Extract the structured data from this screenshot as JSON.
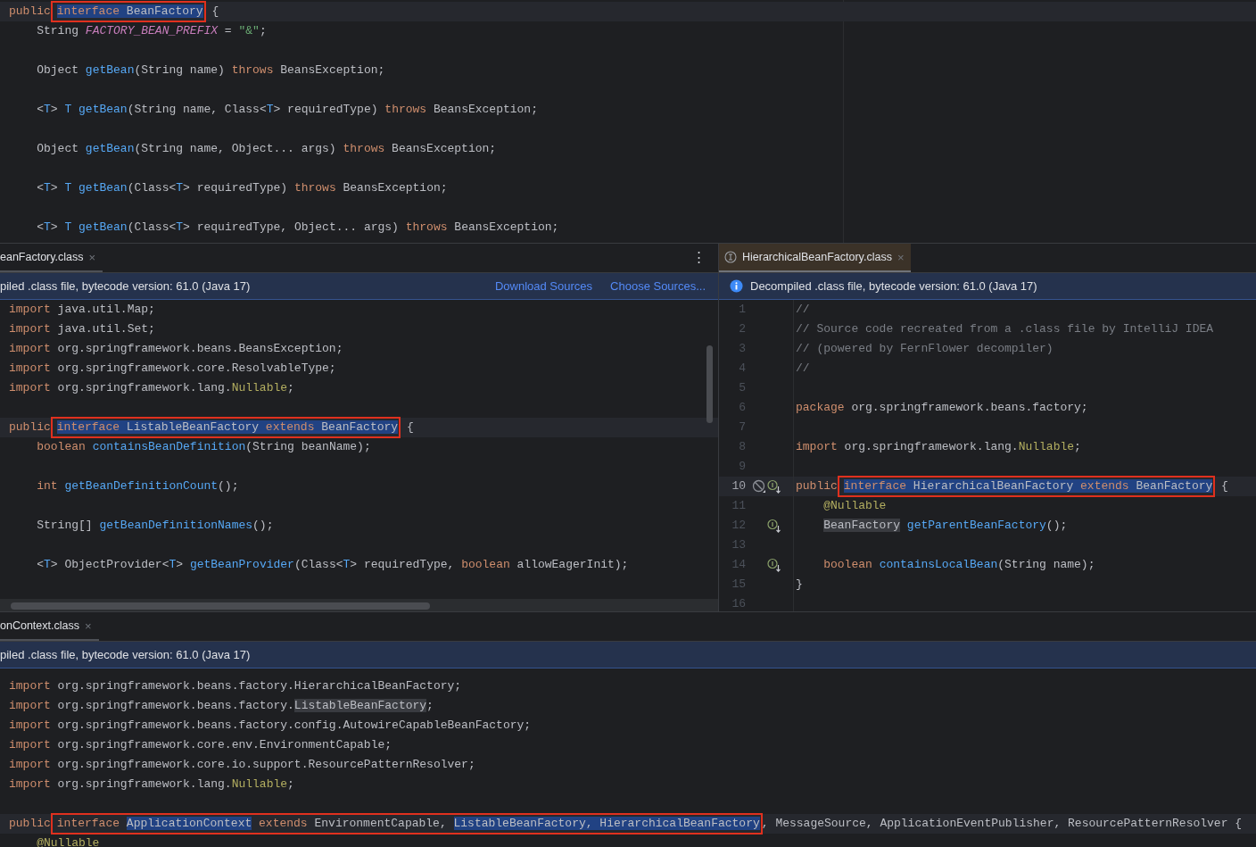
{
  "top_editor": {
    "lines": [
      {
        "kind": "code",
        "current": true,
        "segments": [
          {
            "kind": "kw",
            "text": "public"
          },
          {
            "kind": "box",
            "segments": [
              {
                "kind": "kw",
                "text": "interface ",
                "selected": true
              },
              {
                "kind": "plain",
                "text": "BeanFactory",
                "selected": true
              }
            ]
          },
          {
            "kind": "plain",
            "text": " {"
          }
        ]
      },
      {
        "kind": "code",
        "segments": [
          {
            "kind": "plain",
            "text": "    String "
          },
          {
            "kind": "const",
            "text": "FACTORY_BEAN_PREFIX"
          },
          {
            "kind": "plain",
            "text": " = "
          },
          {
            "kind": "str",
            "text": "\"&\""
          },
          {
            "kind": "plain",
            "text": ";"
          }
        ]
      },
      {
        "kind": "blank"
      },
      {
        "kind": "code",
        "segments": [
          {
            "kind": "plain",
            "text": "    Object "
          },
          {
            "kind": "fn",
            "text": "getBean"
          },
          {
            "kind": "plain",
            "text": "(String name) "
          },
          {
            "kind": "kw",
            "text": "throws"
          },
          {
            "kind": "plain",
            "text": " BeansException;"
          }
        ]
      },
      {
        "kind": "blank"
      },
      {
        "kind": "code",
        "segments": [
          {
            "kind": "plain",
            "text": "    <"
          },
          {
            "kind": "tp",
            "text": "T"
          },
          {
            "kind": "plain",
            "text": "> "
          },
          {
            "kind": "tp",
            "text": "T "
          },
          {
            "kind": "fn",
            "text": "getBean"
          },
          {
            "kind": "plain",
            "text": "(String name, Class<"
          },
          {
            "kind": "tp",
            "text": "T"
          },
          {
            "kind": "plain",
            "text": "> requiredType) "
          },
          {
            "kind": "kw",
            "text": "throws"
          },
          {
            "kind": "plain",
            "text": " BeansException;"
          }
        ]
      },
      {
        "kind": "blank"
      },
      {
        "kind": "code",
        "segments": [
          {
            "kind": "plain",
            "text": "    Object "
          },
          {
            "kind": "fn",
            "text": "getBean"
          },
          {
            "kind": "plain",
            "text": "(String name, Object... args) "
          },
          {
            "kind": "kw",
            "text": "throws"
          },
          {
            "kind": "plain",
            "text": " BeansException;"
          }
        ]
      },
      {
        "kind": "blank"
      },
      {
        "kind": "code",
        "segments": [
          {
            "kind": "plain",
            "text": "    <"
          },
          {
            "kind": "tp",
            "text": "T"
          },
          {
            "kind": "plain",
            "text": "> "
          },
          {
            "kind": "tp",
            "text": "T "
          },
          {
            "kind": "fn",
            "text": "getBean"
          },
          {
            "kind": "plain",
            "text": "(Class<"
          },
          {
            "kind": "tp",
            "text": "T"
          },
          {
            "kind": "plain",
            "text": "> requiredType) "
          },
          {
            "kind": "kw",
            "text": "throws"
          },
          {
            "kind": "plain",
            "text": " BeansException;"
          }
        ]
      },
      {
        "kind": "blank"
      },
      {
        "kind": "code",
        "segments": [
          {
            "kind": "plain",
            "text": "    <"
          },
          {
            "kind": "tp",
            "text": "T"
          },
          {
            "kind": "plain",
            "text": "> "
          },
          {
            "kind": "tp",
            "text": "T "
          },
          {
            "kind": "fn",
            "text": "getBean"
          },
          {
            "kind": "plain",
            "text": "(Class<"
          },
          {
            "kind": "tp",
            "text": "T"
          },
          {
            "kind": "plain",
            "text": "> requiredType, Object... args) "
          },
          {
            "kind": "kw",
            "text": "throws"
          },
          {
            "kind": "plain",
            "text": " BeansException;"
          }
        ]
      }
    ]
  },
  "left_editor": {
    "tab": {
      "label": "eanFactory.class",
      "close": "×",
      "selected": false
    },
    "menu": "⋮",
    "banner": {
      "text": "piled .class file, bytecode version: 61.0 (Java 17)",
      "links": [
        "Download Sources",
        "Choose Sources..."
      ]
    },
    "lines": [
      {
        "kind": "code",
        "segments": [
          {
            "kind": "kw",
            "text": "import"
          },
          {
            "kind": "plain",
            "text": " java.util.Map;"
          }
        ]
      },
      {
        "kind": "code",
        "segments": [
          {
            "kind": "kw",
            "text": "import"
          },
          {
            "kind": "plain",
            "text": " java.util.Set;"
          }
        ]
      },
      {
        "kind": "code",
        "segments": [
          {
            "kind": "kw",
            "text": "import"
          },
          {
            "kind": "plain",
            "text": " org.springframework.beans.BeansException;"
          }
        ]
      },
      {
        "kind": "code",
        "segments": [
          {
            "kind": "kw",
            "text": "import"
          },
          {
            "kind": "plain",
            "text": " org.springframework.core.ResolvableType;"
          }
        ]
      },
      {
        "kind": "code",
        "segments": [
          {
            "kind": "kw",
            "text": "import"
          },
          {
            "kind": "plain",
            "text": " org.springframework.lang."
          },
          {
            "kind": "ann",
            "text": "Nullable"
          },
          {
            "kind": "plain",
            "text": ";"
          }
        ]
      },
      {
        "kind": "blank"
      },
      {
        "kind": "code",
        "current": true,
        "segments": [
          {
            "kind": "kw",
            "text": "public"
          },
          {
            "kind": "box",
            "segments": [
              {
                "kind": "kw",
                "text": "interface ",
                "selected": true
              },
              {
                "kind": "plain",
                "text": "ListableBeanFactory ",
                "selected": true
              },
              {
                "kind": "kw",
                "text": "extends ",
                "selected": true
              },
              {
                "kind": "plain",
                "text": "BeanFactory",
                "selected": true
              }
            ]
          },
          {
            "kind": "plain",
            "text": " {"
          }
        ]
      },
      {
        "kind": "code",
        "segments": [
          {
            "kind": "kw",
            "text": "    boolean "
          },
          {
            "kind": "fn",
            "text": "containsBeanDefinition"
          },
          {
            "kind": "plain",
            "text": "(String beanName);"
          }
        ]
      },
      {
        "kind": "blank"
      },
      {
        "kind": "code",
        "segments": [
          {
            "kind": "kw",
            "text": "    int "
          },
          {
            "kind": "fn",
            "text": "getBeanDefinitionCount"
          },
          {
            "kind": "plain",
            "text": "();"
          }
        ]
      },
      {
        "kind": "blank"
      },
      {
        "kind": "code",
        "segments": [
          {
            "kind": "plain",
            "text": "    String[] "
          },
          {
            "kind": "fn",
            "text": "getBeanDefinitionNames"
          },
          {
            "kind": "plain",
            "text": "();"
          }
        ]
      },
      {
        "kind": "blank"
      },
      {
        "kind": "code",
        "segments": [
          {
            "kind": "plain",
            "text": "    <"
          },
          {
            "kind": "tp",
            "text": "T"
          },
          {
            "kind": "plain",
            "text": "> ObjectProvider<"
          },
          {
            "kind": "tp",
            "text": "T"
          },
          {
            "kind": "plain",
            "text": "> "
          },
          {
            "kind": "fn",
            "text": "getBeanProvider"
          },
          {
            "kind": "plain",
            "text": "(Class<"
          },
          {
            "kind": "tp",
            "text": "T"
          },
          {
            "kind": "plain",
            "text": "> requiredType, "
          },
          {
            "kind": "kw",
            "text": "boolean"
          },
          {
            "kind": "plain",
            "text": " allowEagerInit);"
          }
        ]
      }
    ]
  },
  "right_editor": {
    "tab": {
      "label": "HierarchicalBeanFactory.class",
      "close": "×",
      "selected": true
    },
    "banner": {
      "text": "Decompiled .class file, bytecode version: 61.0 (Java 17)"
    },
    "lines": [
      {
        "number": "1",
        "kind": "code",
        "segments": [
          {
            "kind": "cm",
            "text": "//"
          }
        ]
      },
      {
        "number": "2",
        "kind": "code",
        "segments": [
          {
            "kind": "cm",
            "text": "// Source code recreated from a .class file by IntelliJ IDEA"
          }
        ]
      },
      {
        "number": "3",
        "kind": "code",
        "segments": [
          {
            "kind": "cm",
            "text": "// (powered by FernFlower decompiler)"
          }
        ]
      },
      {
        "number": "4",
        "kind": "code",
        "segments": [
          {
            "kind": "cm",
            "text": "//"
          }
        ]
      },
      {
        "number": "5",
        "kind": "blank"
      },
      {
        "number": "6",
        "kind": "code",
        "segments": [
          {
            "kind": "kw",
            "text": "package"
          },
          {
            "kind": "plain",
            "text": " org.springframework.beans.factory;"
          }
        ]
      },
      {
        "number": "7",
        "kind": "blank"
      },
      {
        "number": "8",
        "kind": "code",
        "segments": [
          {
            "kind": "kw",
            "text": "import"
          },
          {
            "kind": "plain",
            "text": " org.springframework.lang."
          },
          {
            "kind": "ann",
            "text": "Nullable"
          },
          {
            "kind": "plain",
            "text": ";"
          }
        ]
      },
      {
        "number": "9",
        "kind": "blank"
      },
      {
        "number": "10",
        "kind": "code",
        "current": true,
        "gutter": [
          {
            "kind": "slashed-circle"
          },
          {
            "kind": "implemented"
          }
        ],
        "segments": [
          {
            "kind": "kw",
            "text": "public"
          },
          {
            "kind": "box",
            "segments": [
              {
                "kind": "kw",
                "text": "interface ",
                "selected": true
              },
              {
                "kind": "plain",
                "text": "HierarchicalBeanFactory ",
                "selected": true
              },
              {
                "kind": "kw",
                "text": "extends ",
                "selected": true
              },
              {
                "kind": "plain",
                "text": "BeanFactory",
                "selected": true
              }
            ]
          },
          {
            "kind": "plain",
            "text": " {"
          }
        ]
      },
      {
        "number": "11",
        "kind": "code",
        "segments": [
          {
            "kind": "ann",
            "text": "    @Nullable"
          }
        ]
      },
      {
        "number": "12",
        "kind": "code",
        "indented": true,
        "gutter": [
          {
            "kind": "implemented"
          }
        ],
        "segments": [
          {
            "kind": "ref",
            "text": "BeanFactory"
          },
          {
            "kind": "fn",
            "text": " getParentBeanFactory"
          },
          {
            "kind": "plain",
            "text": "();"
          }
        ]
      },
      {
        "number": "13",
        "kind": "blank"
      },
      {
        "number": "14",
        "kind": "code",
        "gutter": [
          {
            "kind": "implemented"
          }
        ],
        "segments": [
          {
            "kind": "kw",
            "text": "    boolean "
          },
          {
            "kind": "fn",
            "text": "containsLocalBean"
          },
          {
            "kind": "plain",
            "text": "(String name);"
          }
        ]
      },
      {
        "number": "15",
        "kind": "code",
        "segments": [
          {
            "kind": "plain",
            "text": "}"
          }
        ]
      },
      {
        "number": "16",
        "kind": "blank"
      }
    ]
  },
  "bottom_editor": {
    "tab": {
      "label": "onContext.class",
      "close": "×",
      "selected": false
    },
    "banner": {
      "text": "piled .class file, bytecode version: 61.0 (Java 17)"
    },
    "lines": [
      {
        "kind": "code",
        "segments": [
          {
            "kind": "kw",
            "text": "import"
          },
          {
            "kind": "plain",
            "text": " org.springframework.beans.factory.HierarchicalBeanFactory;"
          }
        ]
      },
      {
        "kind": "code",
        "segments": [
          {
            "kind": "kw",
            "text": "import"
          },
          {
            "kind": "plain",
            "text": " org.springframework.beans.factory."
          },
          {
            "kind": "ref",
            "text": "ListableBeanFactory"
          },
          {
            "kind": "plain",
            "text": ";"
          }
        ]
      },
      {
        "kind": "code",
        "segments": [
          {
            "kind": "kw",
            "text": "import"
          },
          {
            "kind": "plain",
            "text": " org.springframework.beans.factory.config.AutowireCapableBeanFactory;"
          }
        ]
      },
      {
        "kind": "code",
        "segments": [
          {
            "kind": "kw",
            "text": "import"
          },
          {
            "kind": "plain",
            "text": " org.springframework.core.env.EnvironmentCapable;"
          }
        ]
      },
      {
        "kind": "code",
        "segments": [
          {
            "kind": "kw",
            "text": "import"
          },
          {
            "kind": "plain",
            "text": " org.springframework.core.io.support.ResourcePatternResolver;"
          }
        ]
      },
      {
        "kind": "code",
        "segments": [
          {
            "kind": "kw",
            "text": "import"
          },
          {
            "kind": "plain",
            "text": " org.springframework.lang."
          },
          {
            "kind": "ann",
            "text": "Nullable"
          },
          {
            "kind": "plain",
            "text": ";"
          }
        ]
      },
      {
        "kind": "blank"
      },
      {
        "kind": "code",
        "current": true,
        "segments": [
          {
            "kind": "kw",
            "text": "public"
          },
          {
            "kind": "box",
            "segments": [
              {
                "kind": "kw",
                "text": "interface "
              },
              {
                "kind": "plain",
                "text": "ApplicationContext",
                "selected": true
              },
              {
                "kind": "kw",
                "text": " extends"
              },
              {
                "kind": "plain",
                "text": " EnvironmentCapable, "
              },
              {
                "kind": "plain",
                "text": "ListableBeanFactory, HierarchicalBeanFactory",
                "selected": true
              }
            ]
          },
          {
            "kind": "plain",
            "text": ", MessageSource, ApplicationEventPublisher, ResourcePatternResolver {"
          }
        ]
      },
      {
        "kind": "code",
        "segments": [
          {
            "kind": "ann",
            "text": "    @Nullable"
          }
        ]
      }
    ]
  }
}
